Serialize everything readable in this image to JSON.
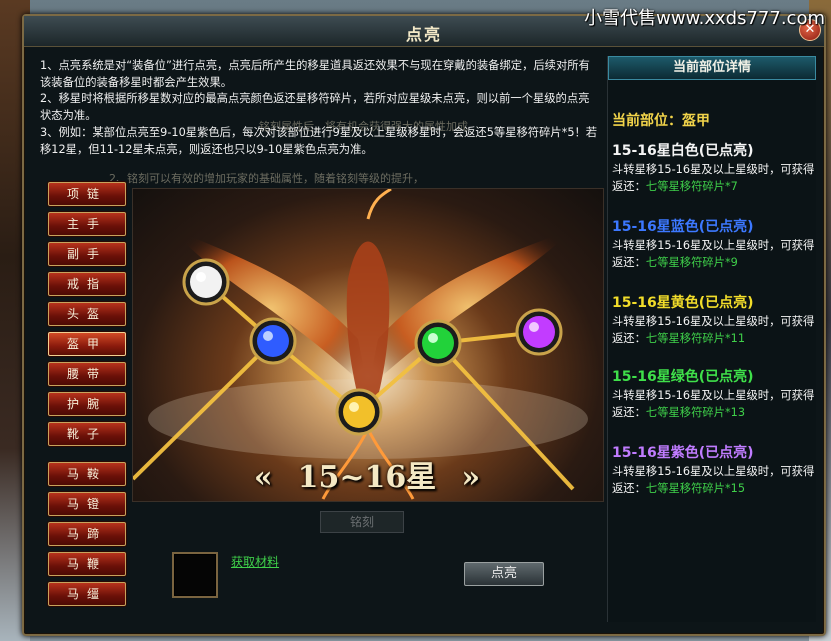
{
  "watermark": "小雪代售www.xxds777.com",
  "window": {
    "title": "点亮",
    "close_icon": "close-icon"
  },
  "description": [
    "1、点亮系统是对“装备位”进行点亮，点亮后所产生的移星道具返还效果不与现在穿戴的装备绑定，后续对所有该装备位的装备移星时都会产生效果。",
    "2、移星时将根据所移星数对应的最高点亮颜色返还星移符碎片，若所对应星级未点亮，则以前一个星级的点亮状态为准。",
    "3、例如：某部位点亮至9-10星紫色后，每次对该部位进行9星及以上星级移星时，会返还5等星移符碎片*5！若移12星，但11-12星未点亮，则返还也只以9-10星紫色点亮为准。"
  ],
  "ghost_text": {
    "line1": "2、铭刻可以有效的增加玩家的基础属性，随着铭刻等级的提升，",
    "line2": "铭刻属性后，将有机会获得强大的属性加成"
  },
  "slots": {
    "main": [
      "项链",
      "主手",
      "副手",
      "戒指",
      "头盔",
      "盔甲",
      "腰带",
      "护腕",
      "靴子"
    ],
    "mount": [
      "马鞍",
      "马镫",
      "马蹄",
      "马鞭",
      "马缰"
    ],
    "selected": "盔甲"
  },
  "stage": {
    "level_label": "15~16星",
    "left_arrows": "«",
    "right_arrows": "»",
    "orbs": [
      {
        "name": "white-orb",
        "color": "#f2f2f2"
      },
      {
        "name": "blue-orb",
        "color": "#2f5cff"
      },
      {
        "name": "yellow-orb",
        "color": "#f2c02a"
      },
      {
        "name": "green-orb",
        "color": "#22d23a"
      },
      {
        "name": "purple-orb",
        "color": "#c23cff"
      }
    ]
  },
  "dim_tab": "铭刻",
  "materials": {
    "link": "获取材料"
  },
  "action_button": "点亮",
  "detail": {
    "header": "当前部位详情",
    "current_part": "当前部位：盔甲",
    "tiers": [
      {
        "title": "15-16星白色(已点亮)",
        "color": "#f4f4f4",
        "desc": "斗转星移15-16星及以上星级时，可获得返还：",
        "reward": "七等星移符碎片*7"
      },
      {
        "title": "15-16星蓝色(已点亮)",
        "color": "#3c78ff",
        "desc": "斗转星移15-16星及以上星级时，可获得返还：",
        "reward": "七等星移符碎片*9"
      },
      {
        "title": "15-16星黄色(已点亮)",
        "color": "#f2dd2a",
        "desc": "斗转星移15-16星及以上星级时，可获得返还：",
        "reward": "七等星移符碎片*11"
      },
      {
        "title": "15-16星绿色(已点亮)",
        "color": "#3fe04a",
        "desc": "斗转星移15-16星及以上星级时，可获得返还：",
        "reward": "七等星移符碎片*13"
      },
      {
        "title": "15-16星紫色(已点亮)",
        "color": "#c07cff",
        "desc": "斗转星移15-16星及以上星级时，可获得返还：",
        "reward": "七等星移符碎片*15"
      }
    ]
  }
}
